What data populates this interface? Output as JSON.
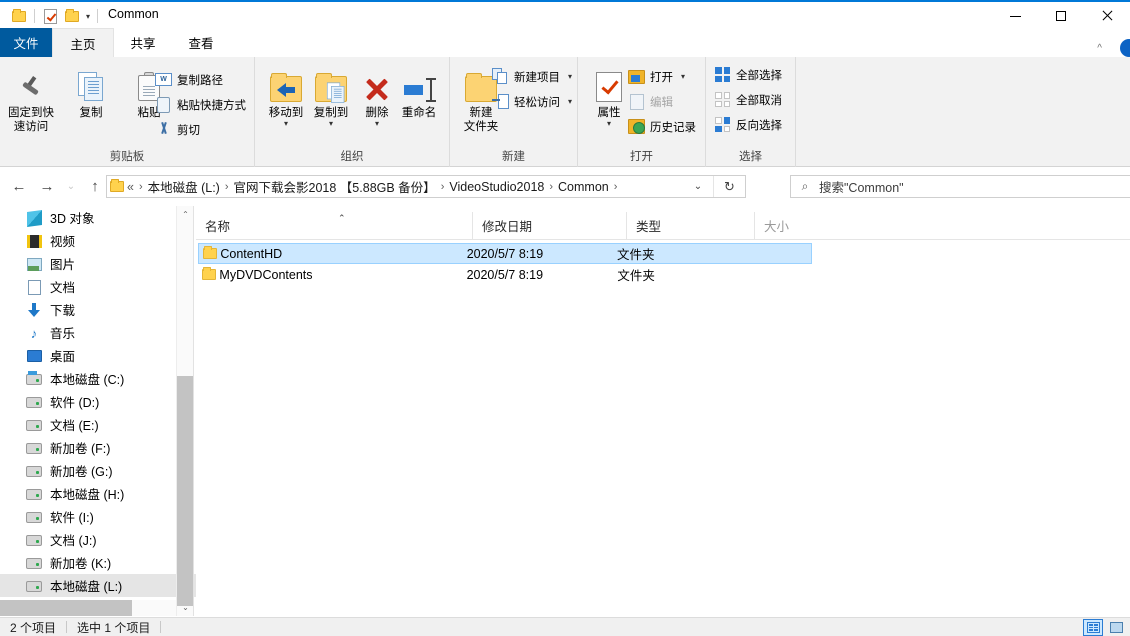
{
  "window": {
    "title": "Common",
    "quick_access": [
      "folder-icon",
      "properties-icon",
      "folder-icon"
    ],
    "caret": "▾",
    "minimize": "—",
    "maximize": "□",
    "close": "✕",
    "collapse_ribbon": "^"
  },
  "tabs": [
    {
      "id": "file",
      "label": "文件"
    },
    {
      "id": "home",
      "label": "主页"
    },
    {
      "id": "share",
      "label": "共享"
    },
    {
      "id": "view",
      "label": "查看"
    }
  ],
  "ribbon": {
    "groups": [
      {
        "id": "clipboard",
        "label": "剪贴板",
        "big": [
          {
            "id": "pin-quick-access",
            "label": "固定到快\n速访问",
            "line1": "固定到快",
            "line2": "速访问"
          },
          {
            "id": "copy",
            "label": "复制"
          },
          {
            "id": "paste",
            "label": "粘贴"
          }
        ],
        "small": [
          {
            "id": "copy-path",
            "label": "复制路径"
          },
          {
            "id": "paste-shortcut",
            "label": "粘贴快捷方式"
          },
          {
            "id": "cut",
            "label": "剪切"
          }
        ]
      },
      {
        "id": "organize",
        "label": "组织",
        "big": [
          {
            "id": "move-to",
            "label": "移动到",
            "dropdown": "▾"
          },
          {
            "id": "copy-to",
            "label": "复制到",
            "dropdown": "▾"
          },
          {
            "id": "delete",
            "label": "删除",
            "dropdown": "▾"
          },
          {
            "id": "rename",
            "label": "重命名"
          }
        ]
      },
      {
        "id": "new",
        "label": "新建",
        "big": [
          {
            "id": "new-folder",
            "line1": "新建",
            "line2": "文件夹"
          }
        ],
        "small": [
          {
            "id": "new-item",
            "label": "新建项目",
            "dropdown": "▾"
          },
          {
            "id": "easy-access",
            "label": "轻松访问",
            "dropdown": "▾"
          }
        ]
      },
      {
        "id": "open",
        "label": "打开",
        "big": [
          {
            "id": "properties",
            "label": "属性",
            "dropdown": "▾"
          }
        ],
        "small": [
          {
            "id": "open",
            "label": "打开",
            "dropdown": "▾"
          },
          {
            "id": "edit",
            "label": "编辑",
            "disabled": true
          },
          {
            "id": "history",
            "label": "历史记录"
          }
        ]
      },
      {
        "id": "select",
        "label": "选择",
        "small": [
          {
            "id": "select-all",
            "label": "全部选择"
          },
          {
            "id": "select-none",
            "label": "全部取消"
          },
          {
            "id": "invert-selection",
            "label": "反向选择"
          }
        ]
      }
    ]
  },
  "nav": {
    "back": "←",
    "forward": "→",
    "recent": "⌄",
    "up": "↑",
    "breadcrumb": [
      "«",
      "本地磁盘 (L:)",
      "官网下载会影2018 【5.88GB 备份】",
      "VideoStudio2018",
      "Common"
    ],
    "breadcrumb_dropdown": "⌄",
    "refresh": "↻"
  },
  "search": {
    "icon": "search-icon",
    "placeholder": "搜索\"Common\""
  },
  "sidebar": {
    "items": [
      {
        "label": "3D 对象",
        "icon": "3d-objects-icon"
      },
      {
        "label": "视频",
        "icon": "videos-icon"
      },
      {
        "label": "图片",
        "icon": "pictures-icon"
      },
      {
        "label": "文档",
        "icon": "documents-icon"
      },
      {
        "label": "下载",
        "icon": "downloads-icon"
      },
      {
        "label": "音乐",
        "icon": "music-icon"
      },
      {
        "label": "桌面",
        "icon": "desktop-icon"
      },
      {
        "label": "本地磁盘 (C:)",
        "icon": "system-drive-icon"
      },
      {
        "label": "软件 (D:)",
        "icon": "drive-icon"
      },
      {
        "label": "文档 (E:)",
        "icon": "drive-icon"
      },
      {
        "label": "新加卷 (F:)",
        "icon": "drive-icon"
      },
      {
        "label": "新加卷 (G:)",
        "icon": "drive-icon"
      },
      {
        "label": "本地磁盘 (H:)",
        "icon": "drive-icon"
      },
      {
        "label": "软件 (I:)",
        "icon": "drive-icon"
      },
      {
        "label": "文档 (J:)",
        "icon": "drive-icon"
      },
      {
        "label": "新加卷 (K:)",
        "icon": "drive-icon"
      },
      {
        "label": "本地磁盘 (L:)",
        "icon": "drive-icon",
        "selected": true
      }
    ],
    "scroll_up": "⌃",
    "scroll_down": "⌄"
  },
  "filelist": {
    "columns": [
      {
        "key": "name",
        "label": "名称",
        "sorted": true,
        "sort_indicator": "⌃"
      },
      {
        "key": "date",
        "label": "修改日期"
      },
      {
        "key": "type",
        "label": "类型"
      },
      {
        "key": "size",
        "label": "大小"
      }
    ],
    "rows": [
      {
        "name": "ContentHD",
        "date": "2020/5/7 8:19",
        "type": "文件夹",
        "size": "",
        "selected": true,
        "icon": "folder-icon"
      },
      {
        "name": "MyDVDContents",
        "date": "2020/5/7 8:19",
        "type": "文件夹",
        "size": "",
        "selected": false,
        "icon": "folder-icon"
      }
    ]
  },
  "statusbar": {
    "item_count": "2 个项目",
    "selection": "选中 1 个项目",
    "views": [
      {
        "id": "details-view",
        "icon": "details-view-icon",
        "active": true
      },
      {
        "id": "large-icons-view",
        "icon": "large-icons-view-icon",
        "active": false
      }
    ]
  },
  "colors": {
    "accent": "#0078d7",
    "file_tab": "#005a9e",
    "selection": "#cce8ff",
    "selection_border": "#99d1ff",
    "ribbon_bg": "#f2f2f2",
    "folder_yellow": "#ffd24d"
  }
}
